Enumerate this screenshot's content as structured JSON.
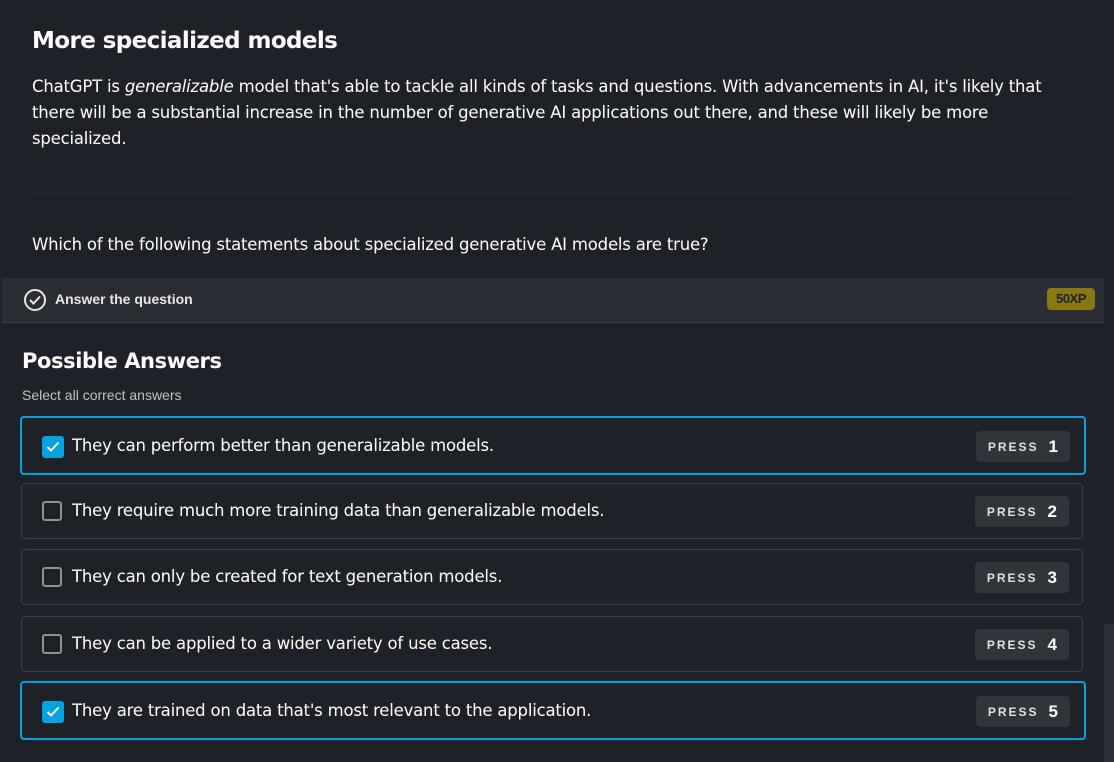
{
  "context": {
    "title": "More specialized models",
    "desc_before": "ChatGPT is ",
    "desc_em": "generalizable",
    "desc_after": " model that's able to tackle all kinds of tasks and questions. With advancements in AI, it's likely that there will be a substantial increase in the number of generative AI applications out there, and these will likely be more specialized.",
    "question": "Which of the following statements about specialized generative AI models are true?"
  },
  "exercise_bar": {
    "label": "Answer the question",
    "xp": "50XP",
    "icon": "check-circle-icon"
  },
  "answers": {
    "title": "Possible Answers",
    "subtitle": "Select all correct answers",
    "press_label": "PRESS",
    "options": [
      {
        "text": "They can perform better than generalizable models.",
        "key": "1",
        "checked": true
      },
      {
        "text": "They require much more training data than generalizable models.",
        "key": "2",
        "checked": false
      },
      {
        "text": "They can only be created for text generation models.",
        "key": "3",
        "checked": false
      },
      {
        "text": "They can be applied to a wider variety of use cases.",
        "key": "4",
        "checked": false
      },
      {
        "text": "They are trained on data that's most relevant to the application.",
        "key": "5",
        "checked": true
      }
    ]
  },
  "colors": {
    "accent": "#06a3de",
    "xp_badge": "#8a7813",
    "background": "#1e2127"
  }
}
